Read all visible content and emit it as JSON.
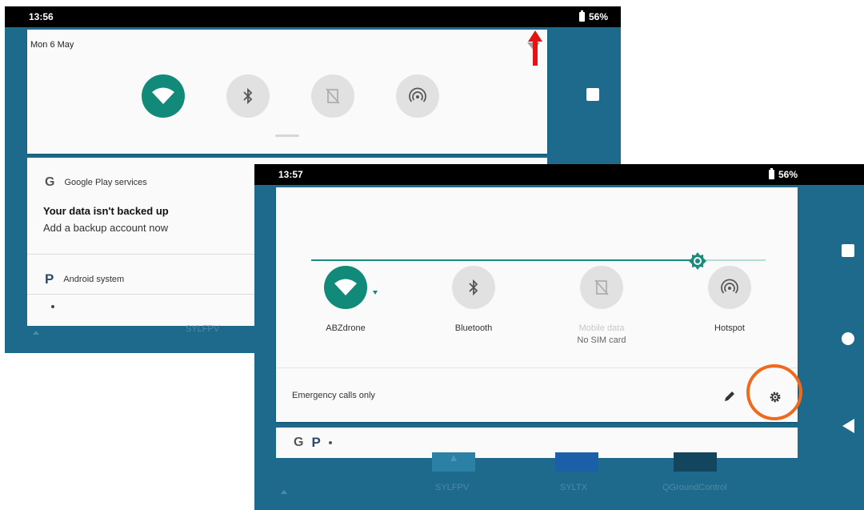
{
  "screen_before": {
    "status_bar": {
      "time": "13:56",
      "battery": "56%"
    },
    "quick_settings": {
      "date": "Mon 6 May",
      "tiles": [
        {
          "icon": "wifi-icon",
          "active": true
        },
        {
          "icon": "bluetooth-icon",
          "active": false
        },
        {
          "icon": "no-sim-icon",
          "active": false
        },
        {
          "icon": "hotspot-icon",
          "active": false
        }
      ]
    },
    "notifications": [
      {
        "app": "Google Play services",
        "title": "Your data isn't backed up",
        "text": "Add a backup account now"
      },
      {
        "app": "Android system"
      }
    ],
    "home_label": "SYLFPV"
  },
  "screen_after": {
    "status_bar": {
      "time": "13:57",
      "battery": "56%"
    },
    "brightness_level": 0.85,
    "tiles": [
      {
        "label": "ABZdrone",
        "sublabel": "",
        "icon": "wifi-icon",
        "active": true
      },
      {
        "label": "Bluetooth",
        "sublabel": "",
        "icon": "bluetooth-icon",
        "active": false
      },
      {
        "label": "Mobile data",
        "sublabel": "No SIM card",
        "icon": "no-sim-icon",
        "active": false
      },
      {
        "label": "Hotspot",
        "sublabel": "",
        "icon": "hotspot-icon",
        "active": false
      }
    ],
    "emergency_text": "Emergency calls only",
    "home_labels": [
      "SYLFPV",
      "SYLTX",
      "QGroundControl"
    ]
  },
  "colors": {
    "accent": "#128a7a",
    "highlight": "#f06a1e",
    "arrow": "#e21414",
    "wallpaper": "#1d6a8c"
  }
}
